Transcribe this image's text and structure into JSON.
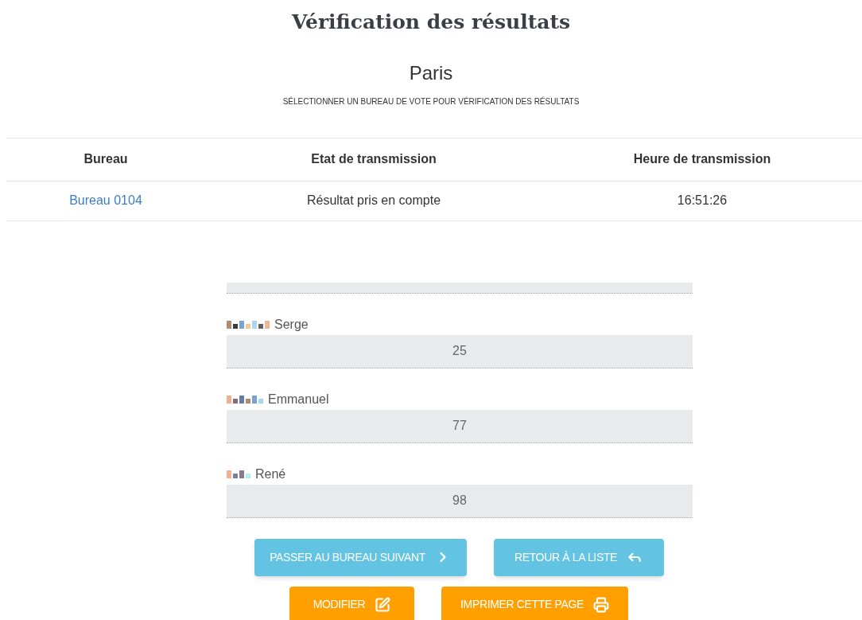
{
  "title": "Vérification des résultats",
  "city": "Paris",
  "instruction": "SÉLECTIONNER UN BUREAU DE VOTE POUR VÉRIFICATION DES RÉSULTATS",
  "table": {
    "columns": [
      "Bureau",
      "Etat de transmission",
      "Heure de transmission"
    ],
    "rows": [
      {
        "bureau": "Bureau 0104",
        "etat": "Résultat pris en compte",
        "heure": "16:51:26"
      }
    ]
  },
  "candidates": [
    {
      "name": "Serge",
      "value": "25"
    },
    {
      "name": "Emmanuel",
      "value": "77"
    },
    {
      "name": "René",
      "value": "98"
    }
  ],
  "buttons": [
    [
      {
        "label": "PASSER AU BUREAU SUIVANT",
        "kind": "next"
      },
      {
        "label": "RETOUR À LA LISTE",
        "kind": "back"
      }
    ],
    [
      {
        "label": "MODIFIER",
        "kind": "edit"
      },
      {
        "label": "IMPRIMER CETTE PAGE",
        "kind": "print"
      }
    ]
  ]
}
